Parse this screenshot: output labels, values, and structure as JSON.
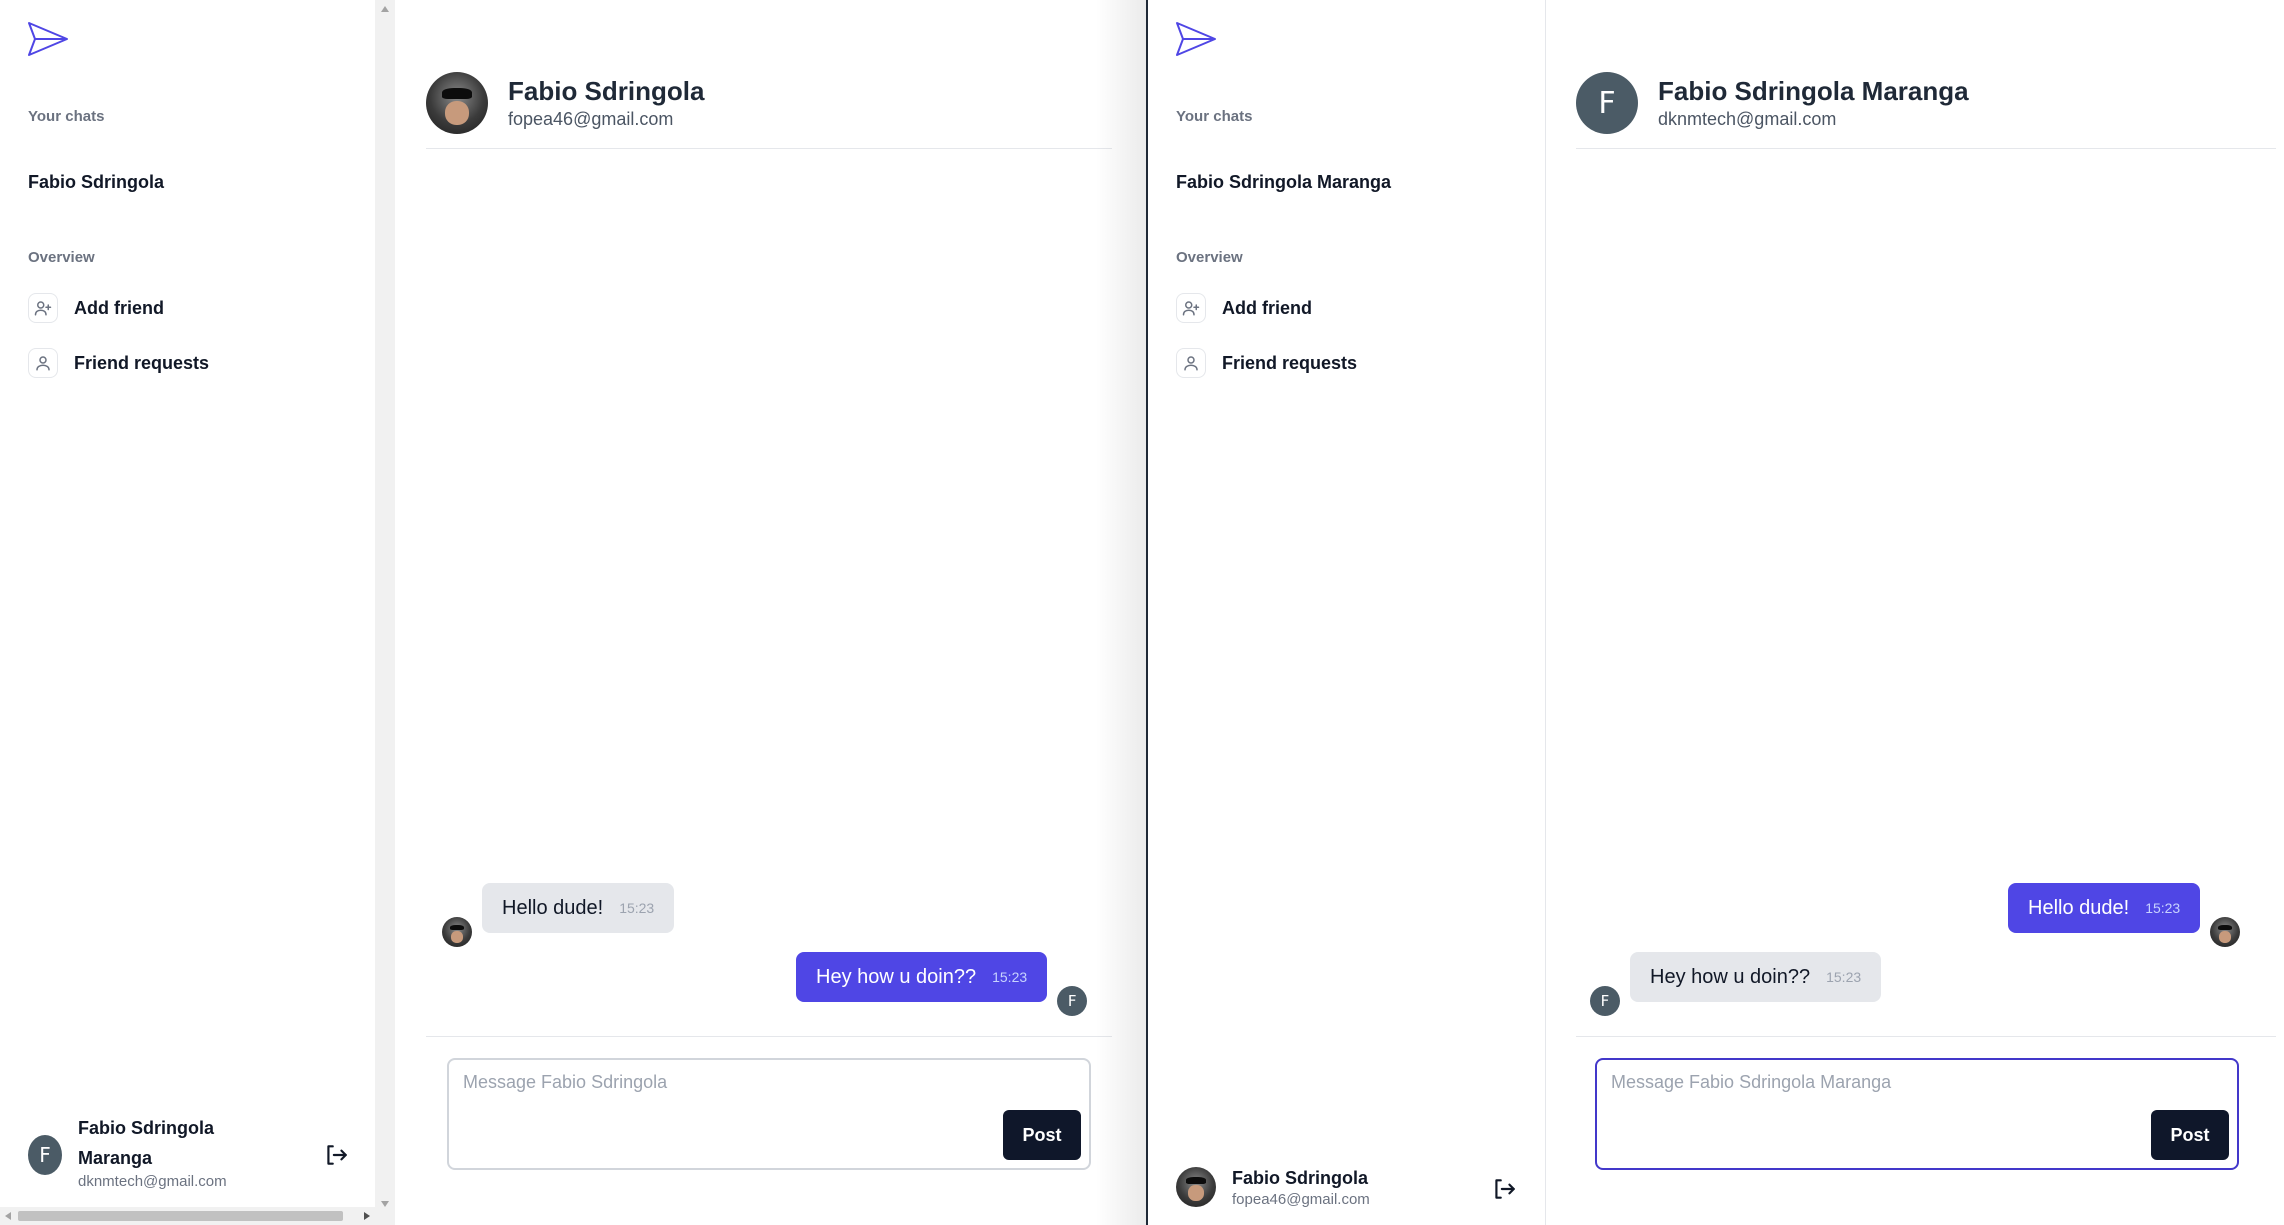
{
  "left_window": {
    "sidebar": {
      "section_chats": "Your chats",
      "chat_item": "Fabio Sdringola",
      "section_overview": "Overview",
      "nav": [
        {
          "label": "Add friend",
          "icon": "user-plus-icon"
        },
        {
          "label": "Friend requests",
          "icon": "user-icon"
        }
      ],
      "profile": {
        "initial": "F",
        "name_line1": "Fabio Sdringola",
        "name_line2": "Maranga",
        "email": "dknmtech@gmail.com"
      }
    },
    "chat": {
      "partner_name": "Fabio Sdringola",
      "partner_email": "fopea46@gmail.com",
      "messages": [
        {
          "text": "Hello dude!",
          "time": "15:23",
          "direction": "incoming"
        },
        {
          "text": "Hey how u doin??",
          "time": "15:23",
          "direction": "outgoing",
          "avatar_initial": "F"
        }
      ],
      "composer_placeholder": "Message Fabio Sdringola",
      "post_label": "Post"
    }
  },
  "right_window": {
    "sidebar": {
      "section_chats": "Your chats",
      "chat_item": "Fabio Sdringola Maranga",
      "section_overview": "Overview",
      "nav": [
        {
          "label": "Add friend",
          "icon": "user-plus-icon"
        },
        {
          "label": "Friend requests",
          "icon": "user-icon"
        }
      ],
      "profile": {
        "name": "Fabio Sdringola",
        "email": "fopea46@gmail.com"
      }
    },
    "chat": {
      "partner_initial": "F",
      "partner_name": "Fabio Sdringola Maranga",
      "partner_email": "dknmtech@gmail.com",
      "messages": [
        {
          "text": "Hello dude!",
          "time": "15:23",
          "direction": "outgoing"
        },
        {
          "text": "Hey how u doin??",
          "time": "15:23",
          "direction": "incoming",
          "avatar_initial": "F"
        }
      ],
      "composer_placeholder": "Message Fabio Sdringola Maranga",
      "post_label": "Post"
    }
  },
  "colors": {
    "accent": "#4f46e5",
    "bubble_incoming": "#e5e7eb",
    "button_dark": "#0f172a",
    "avatar_bg": "#4b5b66"
  }
}
